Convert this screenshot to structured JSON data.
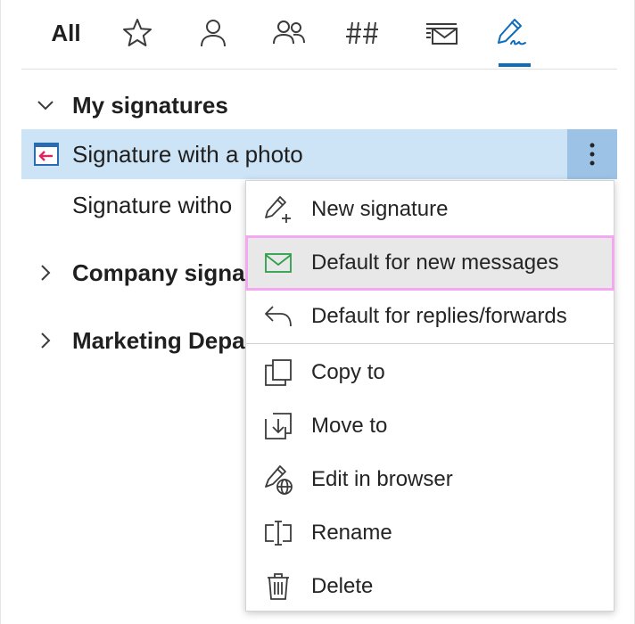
{
  "tabs": {
    "all_label": "All",
    "items": [
      "star-icon",
      "person-icon",
      "people-icon",
      "hash-icon",
      "mail-stack-icon",
      "signature-pen-icon"
    ],
    "accent_color": "#0f6cbd"
  },
  "tree": {
    "groups": [
      {
        "label": "My signatures",
        "expanded": true
      },
      {
        "label": "Company signa",
        "expanded": false
      },
      {
        "label": "Marketing Depa",
        "expanded": false
      }
    ],
    "items": [
      {
        "label": "Signature with a photo",
        "selected": true
      },
      {
        "label": "Signature witho"
      }
    ],
    "selected_color": "#cde4f6"
  },
  "menu": {
    "items": [
      {
        "label": "New signature",
        "icon": "pen-add-icon"
      },
      {
        "label": "Default for new messages",
        "icon": "mail-icon",
        "highlighted": true
      },
      {
        "label": "Default for replies/forwards",
        "icon": "reply-icon"
      },
      {
        "label": "Copy to",
        "icon": "copy-icon"
      },
      {
        "label": "Move to",
        "icon": "move-icon"
      },
      {
        "label": "Edit in browser",
        "icon": "edit-globe-icon"
      },
      {
        "label": "Rename",
        "icon": "rename-icon"
      },
      {
        "label": "Delete",
        "icon": "trash-icon"
      }
    ],
    "highlight_color": "#f4a8f1",
    "mail_icon_color": "#2e9e4a"
  }
}
